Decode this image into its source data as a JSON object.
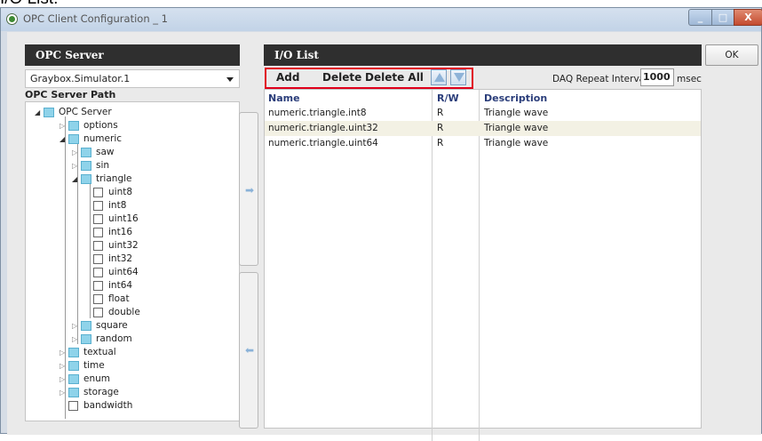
{
  "caption": "I/O List:",
  "window": {
    "title": "OPC Client Configuration _ 1",
    "controls": [
      "_",
      "□",
      "X"
    ]
  },
  "left": {
    "header": "OPC Server",
    "server": "Graybox.Simulator.1",
    "path_label": "OPC Server Path",
    "tree": [
      {
        "label": "OPC Server",
        "level": 0,
        "type": "folder",
        "expanded": true
      },
      {
        "label": "options",
        "level": 1,
        "type": "folder",
        "expanded": false
      },
      {
        "label": "numeric",
        "level": 1,
        "type": "folder",
        "expanded": true
      },
      {
        "label": "saw",
        "level": 2,
        "type": "folder",
        "expanded": false
      },
      {
        "label": "sin",
        "level": 2,
        "type": "folder",
        "expanded": false
      },
      {
        "label": "triangle",
        "level": 2,
        "type": "folder",
        "expanded": true
      },
      {
        "label": "uint8",
        "level": 3,
        "type": "item"
      },
      {
        "label": "int8",
        "level": 3,
        "type": "item"
      },
      {
        "label": "uint16",
        "level": 3,
        "type": "item"
      },
      {
        "label": "int16",
        "level": 3,
        "type": "item"
      },
      {
        "label": "uint32",
        "level": 3,
        "type": "item"
      },
      {
        "label": "int32",
        "level": 3,
        "type": "item"
      },
      {
        "label": "uint64",
        "level": 3,
        "type": "item"
      },
      {
        "label": "int64",
        "level": 3,
        "type": "item"
      },
      {
        "label": "float",
        "level": 3,
        "type": "item"
      },
      {
        "label": "double",
        "level": 3,
        "type": "item"
      },
      {
        "label": "square",
        "level": 2,
        "type": "folder",
        "expanded": false
      },
      {
        "label": "random",
        "level": 2,
        "type": "folder",
        "expanded": false
      },
      {
        "label": "textual",
        "level": 1,
        "type": "folder",
        "expanded": false
      },
      {
        "label": "time",
        "level": 1,
        "type": "folder",
        "expanded": false
      },
      {
        "label": "enum",
        "level": 1,
        "type": "folder",
        "expanded": false
      },
      {
        "label": "storage",
        "level": 1,
        "type": "folder",
        "expanded": false
      },
      {
        "label": "bandwidth",
        "level": 1,
        "type": "item"
      }
    ]
  },
  "right": {
    "header": "I/O List",
    "ok_label": "OK",
    "toolbar": {
      "add": "Add",
      "delete": "Delete",
      "delete_all": "Delete All",
      "daq_label": "DAQ Repeat Interval",
      "daq_value": "1000",
      "daq_unit": "msec"
    },
    "columns": {
      "name": "Name",
      "rw": "R/W",
      "description": "Description"
    },
    "rows": [
      {
        "name": "numeric.triangle.int8",
        "rw": "R",
        "description": "Triangle wave"
      },
      {
        "name": "numeric.triangle.uint32",
        "rw": "R",
        "description": "Triangle wave"
      },
      {
        "name": "numeric.triangle.uint64",
        "rw": "R",
        "description": "Triangle wave"
      }
    ]
  },
  "colors": {
    "header_bg": "#2f2f2f",
    "highlight": "#e0001b",
    "folder_icon": "#8fd3ea",
    "arrow": "#8ab2d8"
  }
}
